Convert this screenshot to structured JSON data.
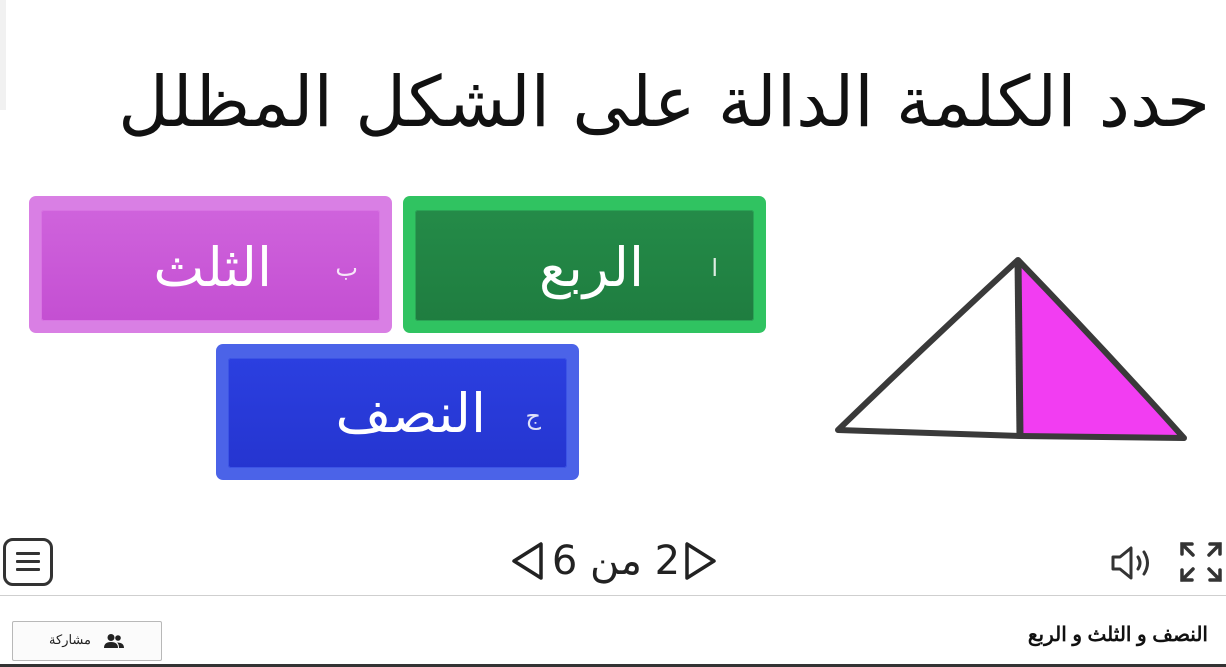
{
  "question": "حدد الكلمة الدالة على الشكل المظلل",
  "answers": [
    {
      "letter": "ا",
      "text": "الربع",
      "color": "#218346"
    },
    {
      "letter": "ب",
      "text": "الثلث",
      "color": "#c95ad7"
    },
    {
      "letter": "ج",
      "text": "النصف",
      "color": "#2839db"
    }
  ],
  "figure": {
    "shaded_color": "#f23df2",
    "outline_color": "#3a3a3a"
  },
  "navigation": {
    "counter": "2 من 6"
  },
  "icons": {
    "menu": "hamburger-menu-icon",
    "prev": "triangle-left-icon",
    "next": "triangle-right-icon",
    "sound": "speaker-icon",
    "fullscreen": "fullscreen-icon",
    "share": "people-icon"
  },
  "footer": {
    "title": "النصف و الثلث و الربع",
    "share_label": "مشاركة"
  }
}
